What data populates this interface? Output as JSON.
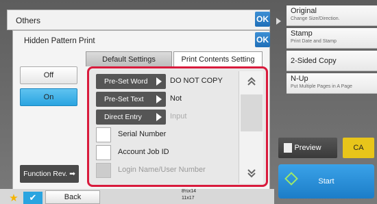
{
  "others": {
    "title": "Others",
    "ok_label": "OK"
  },
  "dialog": {
    "title": "Hidden Pattern Print",
    "ok_label": "OK",
    "off_label": "Off",
    "on_label": "On",
    "function_review_label": "Function Rev.",
    "tabs": [
      {
        "label": "Default Settings",
        "active": false
      },
      {
        "label": "Print Contents Setting",
        "active": true
      }
    ],
    "rows": [
      {
        "button": "Pre-Set Word",
        "value": "DO NOT COPY",
        "placeholder": false
      },
      {
        "button": "Pre-Set Text",
        "value": "Not",
        "placeholder": false
      },
      {
        "button": "Direct Entry",
        "value": "Input",
        "placeholder": true
      }
    ],
    "checks": [
      {
        "label": "Serial Number",
        "enabled": true
      },
      {
        "label": "Account Job ID",
        "enabled": true
      },
      {
        "label": "Login Name/User Number",
        "enabled": false
      }
    ]
  },
  "right_panel": {
    "items": [
      {
        "title": "Original",
        "sub": "Change Size/Direction."
      },
      {
        "title": "Stamp",
        "sub": "Print Date and Stamp"
      },
      {
        "title": "2-Sided Copy",
        "sub": ""
      },
      {
        "title": "N-Up",
        "sub": "Put Multiple Pages in A Page"
      }
    ],
    "preview_label": "Preview",
    "ca_label": "CA",
    "start_label": "Start"
  },
  "bottom": {
    "back_label": "Back",
    "tray_labels": [
      "8½x14",
      "11x17"
    ]
  },
  "colors": {
    "accent_blue": "#2aa4e0",
    "highlight_red": "#d91a3c",
    "ca_yellow": "#e8c51a"
  }
}
